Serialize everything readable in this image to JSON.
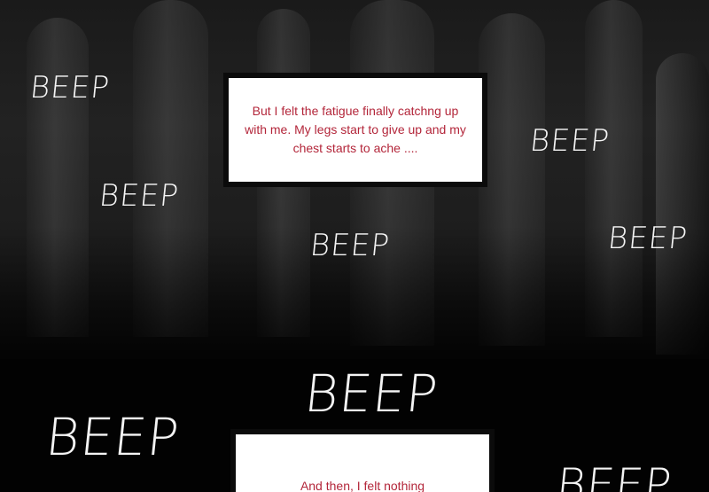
{
  "captions": {
    "first": "But I felt the fatigue finally catchng up with me. My legs start to give up and my chest starts to ache ....",
    "second": "And then, I felt nothing"
  },
  "sfx": {
    "beep": "BEEP"
  },
  "colors": {
    "caption_text": "#b3263a",
    "caption_bg": "#ffffff",
    "sfx_text": "#f4f4f4",
    "background": "#050505"
  }
}
